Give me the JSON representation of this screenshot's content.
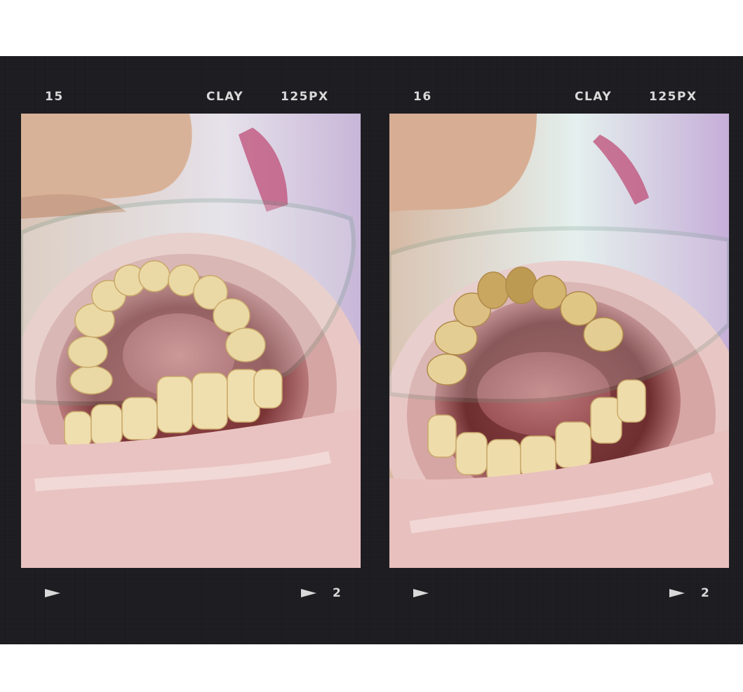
{
  "frames": [
    {
      "frame_number": "15",
      "film_label": "CLAY",
      "iso_label": "125PX",
      "footer_number": "2",
      "photo": "close-up intraoral photo of lower teeth viewed in dental mirror, teeth cleaned"
    },
    {
      "frame_number": "16",
      "film_label": "CLAY",
      "iso_label": "125PX",
      "footer_number": "2",
      "photo": "close-up intraoral photo of lower teeth viewed in dental mirror, with plaque and tartar"
    }
  ],
  "icons": {
    "play_arrow": "play-arrow-icon"
  },
  "colors": {
    "film_background": "#1b1b1f",
    "label_text": "#d9d9d9"
  }
}
